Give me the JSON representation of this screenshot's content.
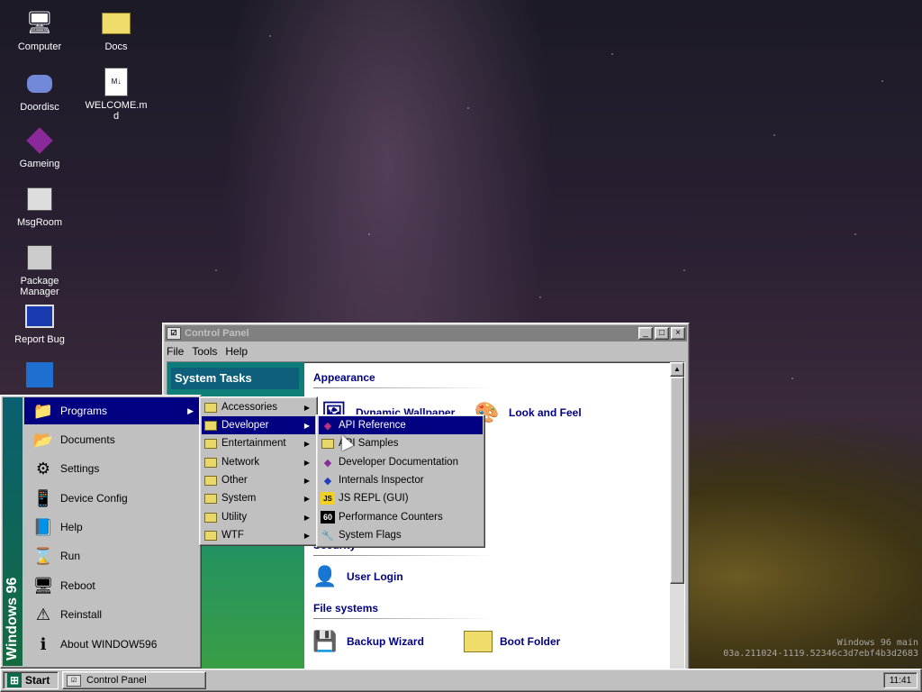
{
  "desktop": {
    "icons": [
      {
        "label": "Computer",
        "icon": "computer-icon"
      },
      {
        "label": "Docs",
        "icon": "folder-icon"
      },
      {
        "label": "Doordisc",
        "icon": "chat-icon"
      },
      {
        "label": "WELCOME.md",
        "icon": "markdown-file-icon"
      },
      {
        "label": "Gameing",
        "icon": "game-icon"
      },
      {
        "label": "MsgRoom",
        "icon": "message-icon"
      },
      {
        "label": "Package Manager",
        "icon": "package-icon"
      },
      {
        "label": "Report Bug",
        "icon": "bug-report-icon"
      }
    ],
    "build_info_line1": "Windows 96 main",
    "build_info_line2": "03a.211024-1119.52346c3d7ebf4b3d2683"
  },
  "window": {
    "title": "Control Panel",
    "menu": [
      "File",
      "Tools",
      "Help"
    ],
    "side_title": "System Tasks",
    "sections": {
      "appearance": "Appearance",
      "security": "Security",
      "filesystems": "File systems"
    },
    "items": {
      "dynamic_wallpaper": "Dynamic Wallpaper",
      "look_and_feel": "Look and Feel",
      "user_login": "User Login",
      "backup_wizard": "Backup Wizard",
      "boot_folder": "Boot Folder"
    }
  },
  "start_menu": {
    "band_text": "Windows 96",
    "items": [
      {
        "label": "Programs",
        "has_sub": true
      },
      {
        "label": "Documents"
      },
      {
        "label": "Settings"
      },
      {
        "label": "Device Config"
      },
      {
        "label": "Help"
      },
      {
        "label": "Run"
      },
      {
        "label": "Reboot"
      },
      {
        "label": "Reinstall"
      },
      {
        "label": "About WINDOW596"
      }
    ]
  },
  "programs_menu": {
    "items": [
      "Accessories",
      "Developer",
      "Entertainment",
      "Network",
      "Other",
      "System",
      "Utility",
      "WTF"
    ]
  },
  "developer_menu": {
    "items": [
      {
        "label": "API Reference"
      },
      {
        "label": "API Samples"
      },
      {
        "label": "Developer Documentation"
      },
      {
        "label": "Internals Inspector"
      },
      {
        "label": "JS REPL (GUI)"
      },
      {
        "label": "Performance Counters"
      },
      {
        "label": "System Flags"
      }
    ]
  },
  "taskbar": {
    "start_label": "Start",
    "task_label": "Control Panel",
    "clock": "11:41"
  },
  "colors": {
    "highlight": "#000080",
    "face": "#c0c0c0",
    "side_panel": "#0d7b7b"
  }
}
